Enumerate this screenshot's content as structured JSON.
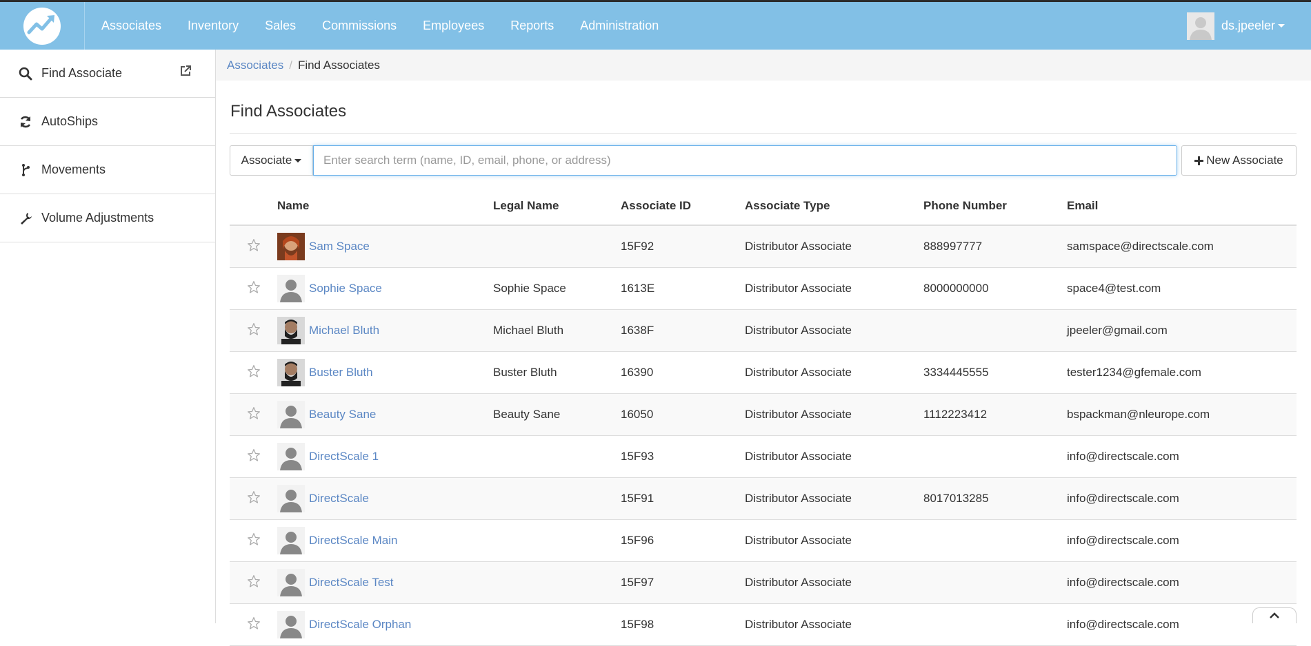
{
  "nav": {
    "items": [
      {
        "label": "Associates"
      },
      {
        "label": "Inventory"
      },
      {
        "label": "Sales"
      },
      {
        "label": "Commissions"
      },
      {
        "label": "Employees"
      },
      {
        "label": "Reports"
      },
      {
        "label": "Administration"
      }
    ],
    "user": "ds.jpeeler"
  },
  "sidebar": {
    "items": [
      {
        "label": "Find Associate",
        "icon": "search-icon"
      },
      {
        "label": "AutoShips",
        "icon": "refresh-icon"
      },
      {
        "label": "Movements",
        "icon": "branch-icon"
      },
      {
        "label": "Volume Adjustments",
        "icon": "wrench-icon"
      }
    ]
  },
  "breadcrumb": {
    "parent": "Associates",
    "separator": "/",
    "current": "Find Associates"
  },
  "page": {
    "title": "Find Associates",
    "search_type": "Associate",
    "search_placeholder": "Enter search term (name, ID, email, phone, or address)",
    "new_button": "New Associate"
  },
  "table": {
    "columns": [
      "Name",
      "Legal Name",
      "Associate ID",
      "Associate Type",
      "Phone Number",
      "Email"
    ],
    "rows": [
      {
        "name": "Sam Space",
        "legal": "",
        "id": "15F92",
        "type": "Distributor Associate",
        "phone": "888997777",
        "email": "samspace@directscale.com",
        "avatar": "photo-red"
      },
      {
        "name": "Sophie Space",
        "legal": "Sophie Space",
        "id": "1613E",
        "type": "Distributor Associate",
        "phone": "8000000000",
        "email": "space4@test.com",
        "avatar": "silhouette"
      },
      {
        "name": "Michael Bluth",
        "legal": "Michael Bluth",
        "id": "1638F",
        "type": "Distributor Associate",
        "phone": "",
        "email": "jpeeler@gmail.com",
        "avatar": "photo-dark"
      },
      {
        "name": "Buster Bluth",
        "legal": "Buster Bluth",
        "id": "16390",
        "type": "Distributor Associate",
        "phone": "3334445555",
        "email": "tester1234@gfemale.com",
        "avatar": "photo-dark"
      },
      {
        "name": "Beauty Sane",
        "legal": "Beauty Sane",
        "id": "16050",
        "type": "Distributor Associate",
        "phone": "1112223412",
        "email": "bspackman@nleurope.com",
        "avatar": "silhouette"
      },
      {
        "name": "DirectScale 1",
        "legal": "",
        "id": "15F93",
        "type": "Distributor Associate",
        "phone": "",
        "email": "info@directscale.com",
        "avatar": "silhouette"
      },
      {
        "name": "DirectScale",
        "legal": "",
        "id": "15F91",
        "type": "Distributor Associate",
        "phone": "8017013285",
        "email": "info@directscale.com",
        "avatar": "silhouette"
      },
      {
        "name": "DirectScale Main",
        "legal": "",
        "id": "15F96",
        "type": "Distributor Associate",
        "phone": "",
        "email": "info@directscale.com",
        "avatar": "silhouette"
      },
      {
        "name": "DirectScale Test",
        "legal": "",
        "id": "15F97",
        "type": "Distributor Associate",
        "phone": "",
        "email": "info@directscale.com",
        "avatar": "silhouette"
      },
      {
        "name": "DirectScale Orphan",
        "legal": "",
        "id": "15F98",
        "type": "Distributor Associate",
        "phone": "",
        "email": "info@directscale.com",
        "avatar": "silhouette"
      }
    ]
  },
  "colors": {
    "topbar": "#82c0e6",
    "link": "#5b87c4",
    "focus": "#66afe9"
  }
}
